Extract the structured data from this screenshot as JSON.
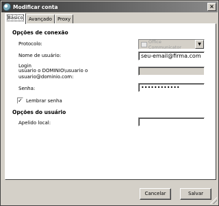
{
  "window": {
    "title": "Modificar conta",
    "close_label": "×"
  },
  "tabs": [
    {
      "label": "Básico",
      "active": true
    },
    {
      "label": "Avançado",
      "active": false
    },
    {
      "label": "Proxy",
      "active": false
    }
  ],
  "connection": {
    "section_title": "Opções de conexão",
    "protocol_label": "Protocolo:",
    "protocol_value": "Office Communicator",
    "username_label": "Nome de usuário:",
    "username_value": "seu-email@firma.com",
    "login_label": "Login",
    "login_hint": "usuario o DOMINIO\\usuario o usuario@dominio.com:",
    "login_value": "",
    "password_label": "Senha:",
    "password_value": "••••••••••••",
    "remember_label": "Lembrar senha",
    "remember_checked": true
  },
  "user_options": {
    "section_title": "Opções do usuário",
    "alias_label": "Apelido local:",
    "alias_value": ""
  },
  "footer": {
    "cancel_label": "Cancelar",
    "save_label": "Salvar"
  },
  "colors": {
    "dialog_bg": "#d4d0c8",
    "titlebar_start": "#3a3a3a",
    "titlebar_end": "#8a8a8a"
  }
}
